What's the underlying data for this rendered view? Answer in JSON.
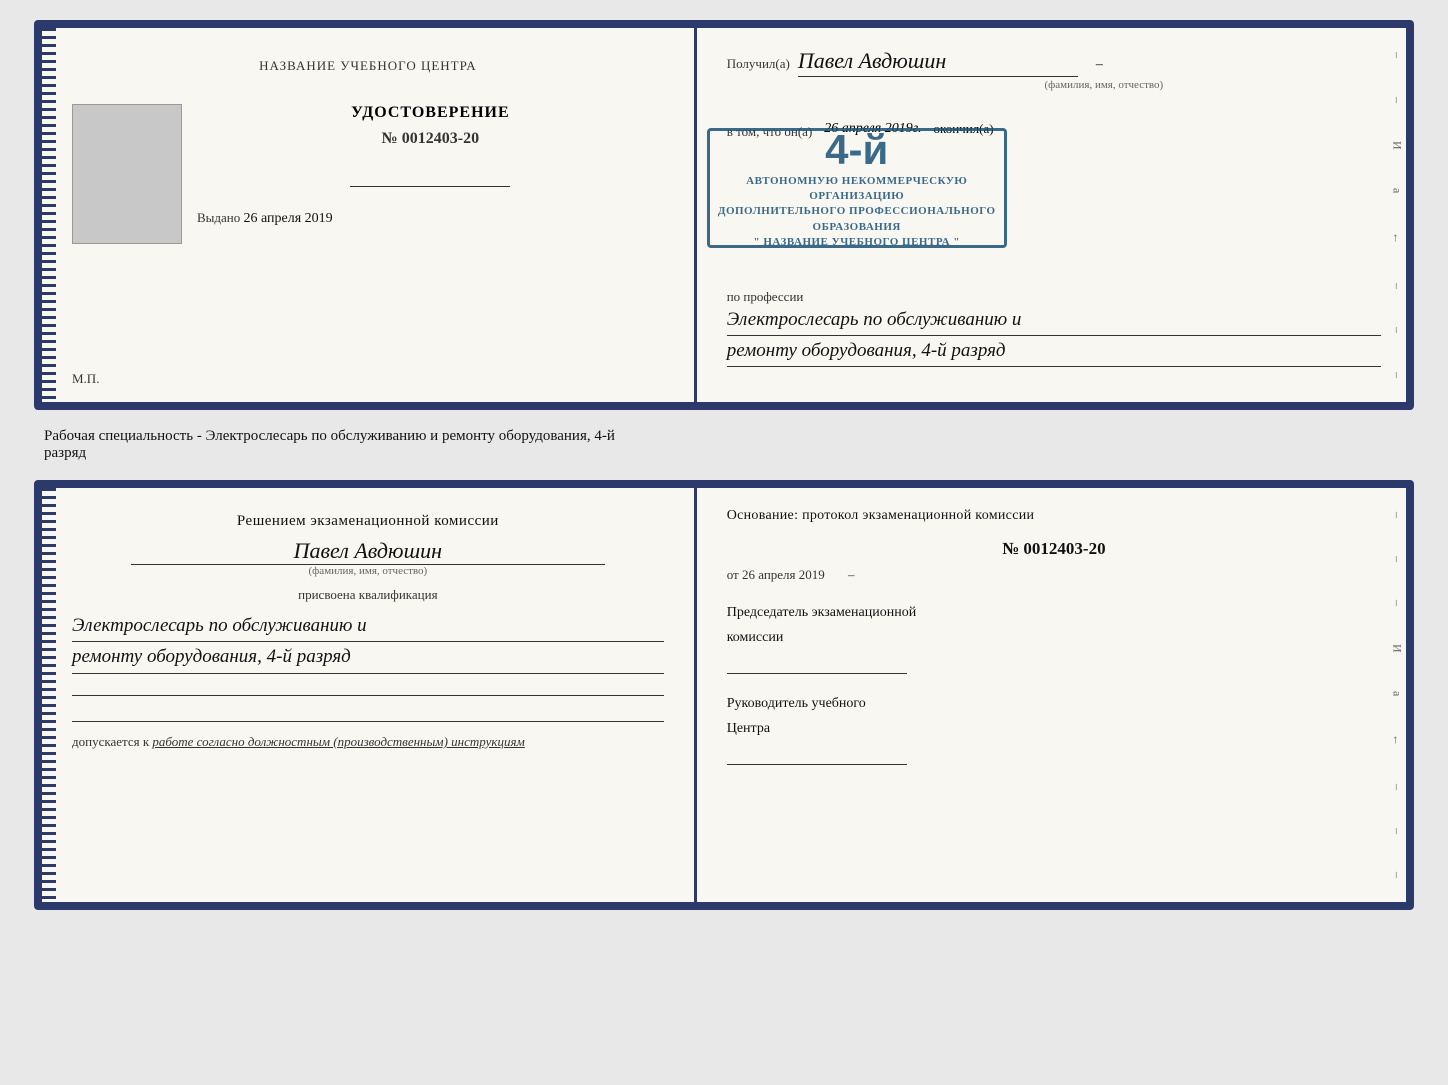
{
  "topDoc": {
    "left": {
      "centerTitle": "НАЗВАНИЕ УЧЕБНОГО ЦЕНТРА",
      "certLabel": "УДОСТОВЕРЕНИЕ",
      "certNumber": "№ 0012403-20",
      "issuedLabel": "Выдано",
      "issuedDate": "26 апреля 2019",
      "mpLabel": "М.П."
    },
    "right": {
      "receivedLabel": "Получил(а)",
      "personName": "Павел Авдюшин",
      "fioSubtitle": "(фамилия, имя, отчество)",
      "vitomLabel": "в том, что он(а)",
      "dateHandwritten": "26 апреля 2019г.",
      "okonchilLabel": "окончил(а)",
      "stampNumber": "4-й",
      "stampLine1": "АВТОНОМНУЮ НЕКОММЕРЧЕСКУЮ ОРГАНИЗАЦИЮ",
      "stampLine2": "ДОПОЛНИТЕЛЬНОГО ПРОФЕССИОНАЛЬНОГО ОБРАЗОВАНИЯ",
      "stampLine3": "\" НАЗВАНИЕ УЧЕБНОГО ЦЕНТРА \"",
      "professionLabel": "по профессии",
      "professionLine1": "Электрослесарь по обслуживанию и",
      "professionLine2": "ремонту оборудования, 4-й разряд"
    }
  },
  "middleText": {
    "line1": "Рабочая специальность - Электрослесарь по обслуживанию и ремонту оборудования, 4-й",
    "line2": "разряд"
  },
  "bottomDoc": {
    "left": {
      "komissiaTitle": "Решением экзаменационной комиссии",
      "personName": "Павел Авдюшин",
      "fioSubtitle": "(фамилия, имя, отчество)",
      "prisvoenaLabel": "присвоена квалификация",
      "qualLine1": "Электрослесарь по обслуживанию и",
      "qualLine2": "ремонту оборудования, 4-й разряд",
      "dopuskLabel": "допускается к",
      "dopuskHandwritten": "работе согласно должностным (производственным) инструкциям"
    },
    "right": {
      "osnovanieLabelLine1": "Основание: протокол экзаменационной комиссии",
      "protocolNumber": "№ 0012403-20",
      "otLabel": "от",
      "otDate": "26 апреля 2019",
      "predsedatelLine1": "Председатель экзаменационной",
      "predsedatelLine2": "комиссии",
      "rukovoditelLine1": "Руководитель учебного",
      "rukovoditelLine2": "Центра"
    }
  },
  "sideStrip": {
    "chars": [
      "И",
      "а",
      "←",
      "–",
      "–",
      "–",
      "–"
    ]
  }
}
